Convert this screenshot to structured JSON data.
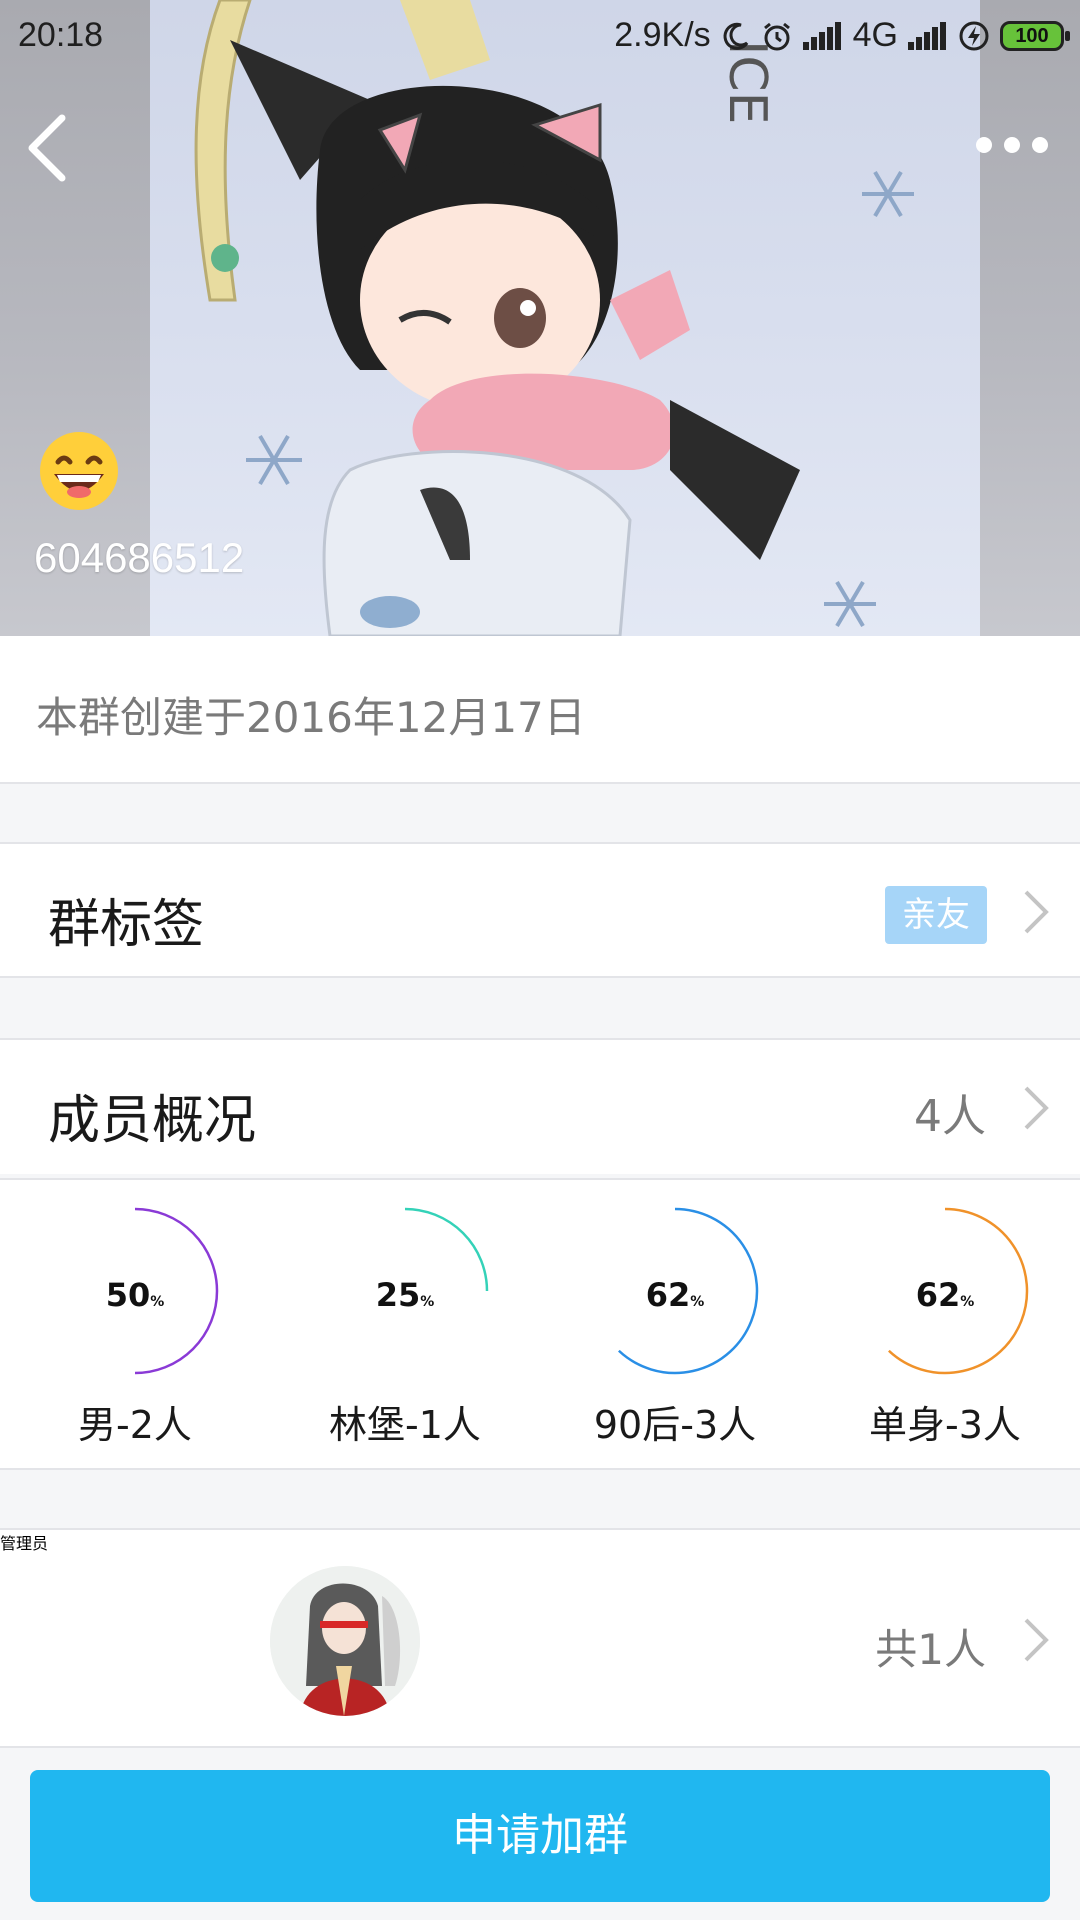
{
  "status_bar": {
    "time": "20:18",
    "net_speed": "2.9K/s",
    "network": "4G",
    "battery": "100"
  },
  "group": {
    "id": "604686512",
    "created_text": "本群创建于2016年12月17日"
  },
  "tags": {
    "title": "群标签",
    "badge": "亲友"
  },
  "members": {
    "title": "成员概况",
    "count": "4人",
    "stats": [
      {
        "pct": "50",
        "unit": "%",
        "label": "男-2人",
        "value": 0.5,
        "color": "#8a3ad6"
      },
      {
        "pct": "25",
        "unit": "%",
        "label": "林堡-1人",
        "value": 0.25,
        "color": "#34d2b8"
      },
      {
        "pct": "62",
        "unit": "%",
        "label": "90后-3人",
        "value": 0.62,
        "color": "#2a8fe6"
      },
      {
        "pct": "62",
        "unit": "%",
        "label": "单身-3人",
        "value": 0.62,
        "color": "#f0922a"
      }
    ]
  },
  "admin": {
    "title": "管理员",
    "count": "共1人"
  },
  "join_button": "申请加群",
  "icons": {
    "back": "back-arrow-icon",
    "more": "more-dots-icon",
    "chevron": "chevron-right-icon",
    "emoji": "grinning-emoji-icon"
  }
}
